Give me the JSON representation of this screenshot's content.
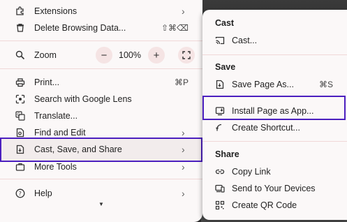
{
  "main_menu": {
    "extensions": "Extensions",
    "delete_browsing_data": "Delete Browsing Data...",
    "delete_shortcut": "⇧⌘⌫",
    "zoom_label": "Zoom",
    "zoom_minus": "−",
    "zoom_value": "100%",
    "zoom_plus": "+",
    "print": "Print...",
    "print_shortcut": "⌘P",
    "search_lens": "Search with Google Lens",
    "translate": "Translate...",
    "find_edit": "Find and Edit",
    "cast_save_share": "Cast, Save, and Share",
    "more_tools": "More Tools",
    "help": "Help"
  },
  "submenu": {
    "cast_header": "Cast",
    "cast_item": "Cast...",
    "save_header": "Save",
    "save_page_as": "Save Page As...",
    "save_shortcut": "⌘S",
    "install_app": "Install Page as App...",
    "create_shortcut": "Create Shortcut...",
    "share_header": "Share",
    "copy_link": "Copy Link",
    "send_devices": "Send to Your Devices",
    "qr_code": "Create QR Code"
  },
  "colors": {
    "highlight_border": "#4b1fbf",
    "menu_bg": "#fbf8f8",
    "hover_bg": "#f2ecec"
  }
}
